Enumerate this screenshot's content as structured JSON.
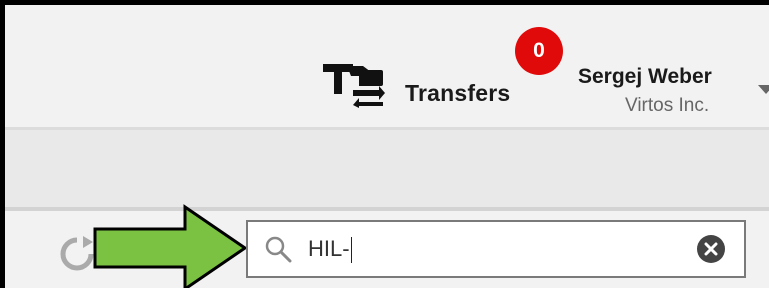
{
  "header": {
    "transfers": {
      "icon": "transfers-icon",
      "label": "Transfers"
    },
    "notifications": {
      "count": "0",
      "color": "#e10a0a"
    },
    "user": {
      "name": "Sergej Weber",
      "company": "Virtos Inc.",
      "menu_icon": "caret-down-icon"
    }
  },
  "toolbar": {
    "refresh_icon": "refresh-icon",
    "annotation_arrow_color": "#7cc242",
    "search": {
      "icon": "search-icon",
      "value": "HIL-",
      "clear_icon": "clear-circle-x-icon"
    }
  }
}
